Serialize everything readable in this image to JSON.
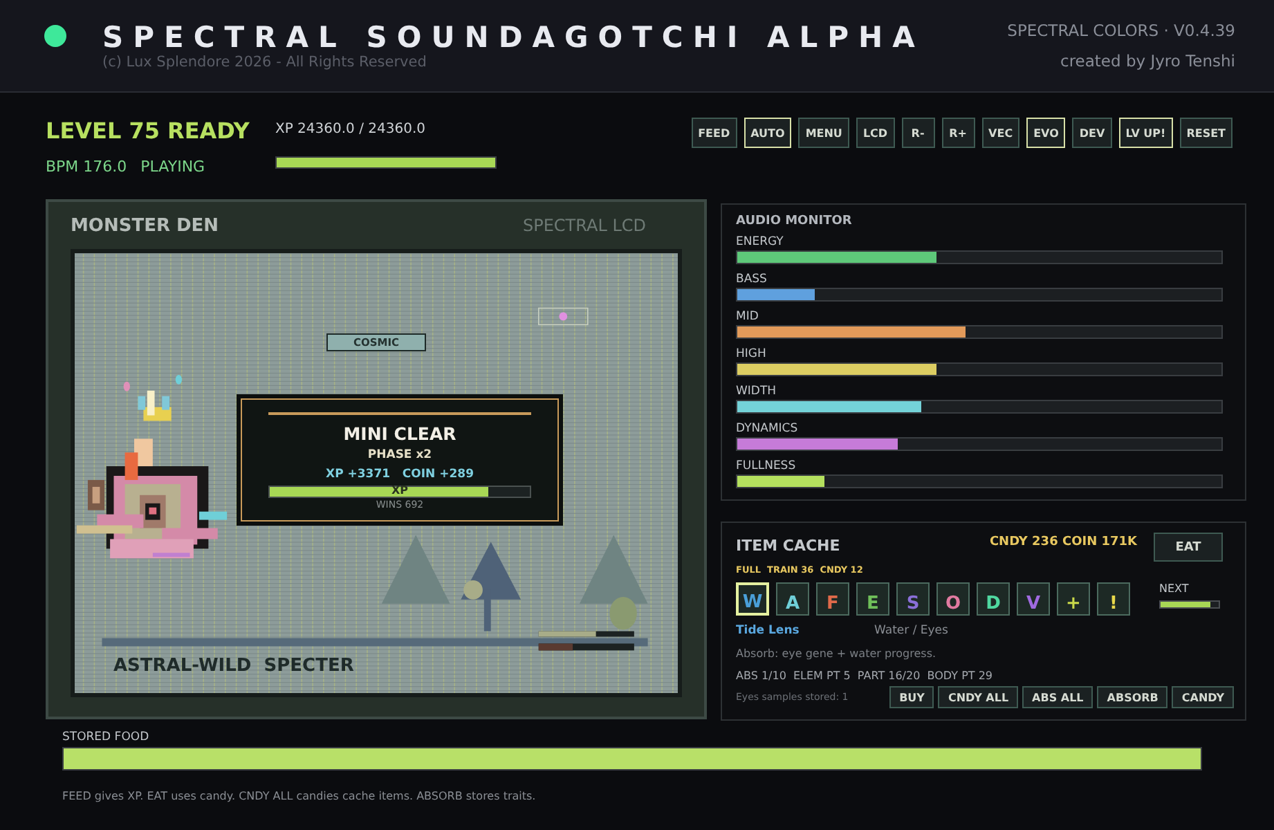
{
  "header": {
    "status_on": true,
    "title": "SPECTRAL SOUNDAGOTCHI ALPHA",
    "copyright": "(c) Lux Splendore 2026 - All Rights Reserved",
    "version": "SPECTRAL COLORS · V0.4.39",
    "credit": "created by Jyro Tenshi"
  },
  "status": {
    "level": "LEVEL 75 READY",
    "bpm": "BPM 176.0",
    "state": "PLAYING",
    "xp": "XP 24360.0 / 24360.0",
    "xp_bar": {
      "level": 1.0
    }
  },
  "toolbar": [
    {
      "label": "FEED",
      "on": false
    },
    {
      "label": "AUTO",
      "on": true
    },
    {
      "label": "MENU",
      "on": false
    },
    {
      "label": "LCD",
      "on": false
    },
    {
      "label": "R-",
      "on": false
    },
    {
      "label": "R+",
      "on": false
    },
    {
      "label": "VEC",
      "on": false
    },
    {
      "label": "EVO",
      "on": true
    },
    {
      "label": "DEV",
      "on": false
    },
    {
      "label": "LV UP!",
      "on": true
    },
    {
      "label": "RESET",
      "on": false
    }
  ],
  "den": {
    "title": "MONSTER DEN",
    "mode": "SPECTRAL LCD",
    "tag": "COSMIC",
    "creature": "ASTRAL-WILD  SPECTER",
    "popup": {
      "title": "MINI CLEAR",
      "phase": "PHASE x2",
      "reward": "XP +3371   COIN +289",
      "bar_label": "XP",
      "level": 0.84,
      "wins": "WINS 692"
    }
  },
  "audio_monitor": {
    "title": "AUDIO MONITOR",
    "meters": [
      {
        "name": "ENERGY",
        "level": 0.41,
        "color": "#5ec97a"
      },
      {
        "name": "BASS",
        "level": 0.16,
        "color": "#5fa0de"
      },
      {
        "name": "MID",
        "level": 0.47,
        "color": "#e29a5a"
      },
      {
        "name": "HIGH",
        "level": 0.41,
        "color": "#dccd62"
      },
      {
        "name": "WIDTH",
        "level": 0.38,
        "color": "#74d2d8"
      },
      {
        "name": "DYNAMICS",
        "level": 0.33,
        "color": "#c67bd8"
      },
      {
        "name": "FULLNESS",
        "level": 0.18,
        "color": "#b4e05e"
      }
    ]
  },
  "item_cache": {
    "title": "ITEM CACHE",
    "totals": "CNDY 236  COIN 171K",
    "eat": "EAT",
    "counts": "FULL  TRAIN 36  CNDY 12",
    "next": "NEXT",
    "next_bar": {
      "level": 0.86
    },
    "items": [
      {
        "glyph": "W",
        "color": "#4a9fd8",
        "selected": true
      },
      {
        "glyph": "A",
        "color": "#6fcfd8",
        "selected": false
      },
      {
        "glyph": "F",
        "color": "#e06a4a",
        "selected": false
      },
      {
        "glyph": "E",
        "color": "#6fbf5a",
        "selected": false
      },
      {
        "glyph": "S",
        "color": "#8a6fd8",
        "selected": false
      },
      {
        "glyph": "O",
        "color": "#e07aa0",
        "selected": false
      },
      {
        "glyph": "D",
        "color": "#4fd8a0",
        "selected": false
      },
      {
        "glyph": "V",
        "color": "#a06ae0",
        "selected": false
      },
      {
        "glyph": "+",
        "color": "#c8d84a",
        "selected": false
      },
      {
        "glyph": "!",
        "color": "#e8d84a",
        "selected": false
      }
    ],
    "item_name": "Tide Lens",
    "item_type": "Water / Eyes",
    "description": "Absorb: eye gene + water progress.",
    "stats": "ABS 1/10  ELEM PT 5  PART 16/20  BODY PT 29",
    "samples": "Eyes samples stored: 1",
    "actions": [
      "BUY",
      "CNDY ALL",
      "ABS ALL",
      "ABSORB",
      "CANDY"
    ]
  },
  "stored_food": {
    "label": "STORED FOOD",
    "level": 1.0
  },
  "footer": "FEED gives XP. EAT uses candy. CNDY ALL candies cache items. ABSORB stores traits."
}
